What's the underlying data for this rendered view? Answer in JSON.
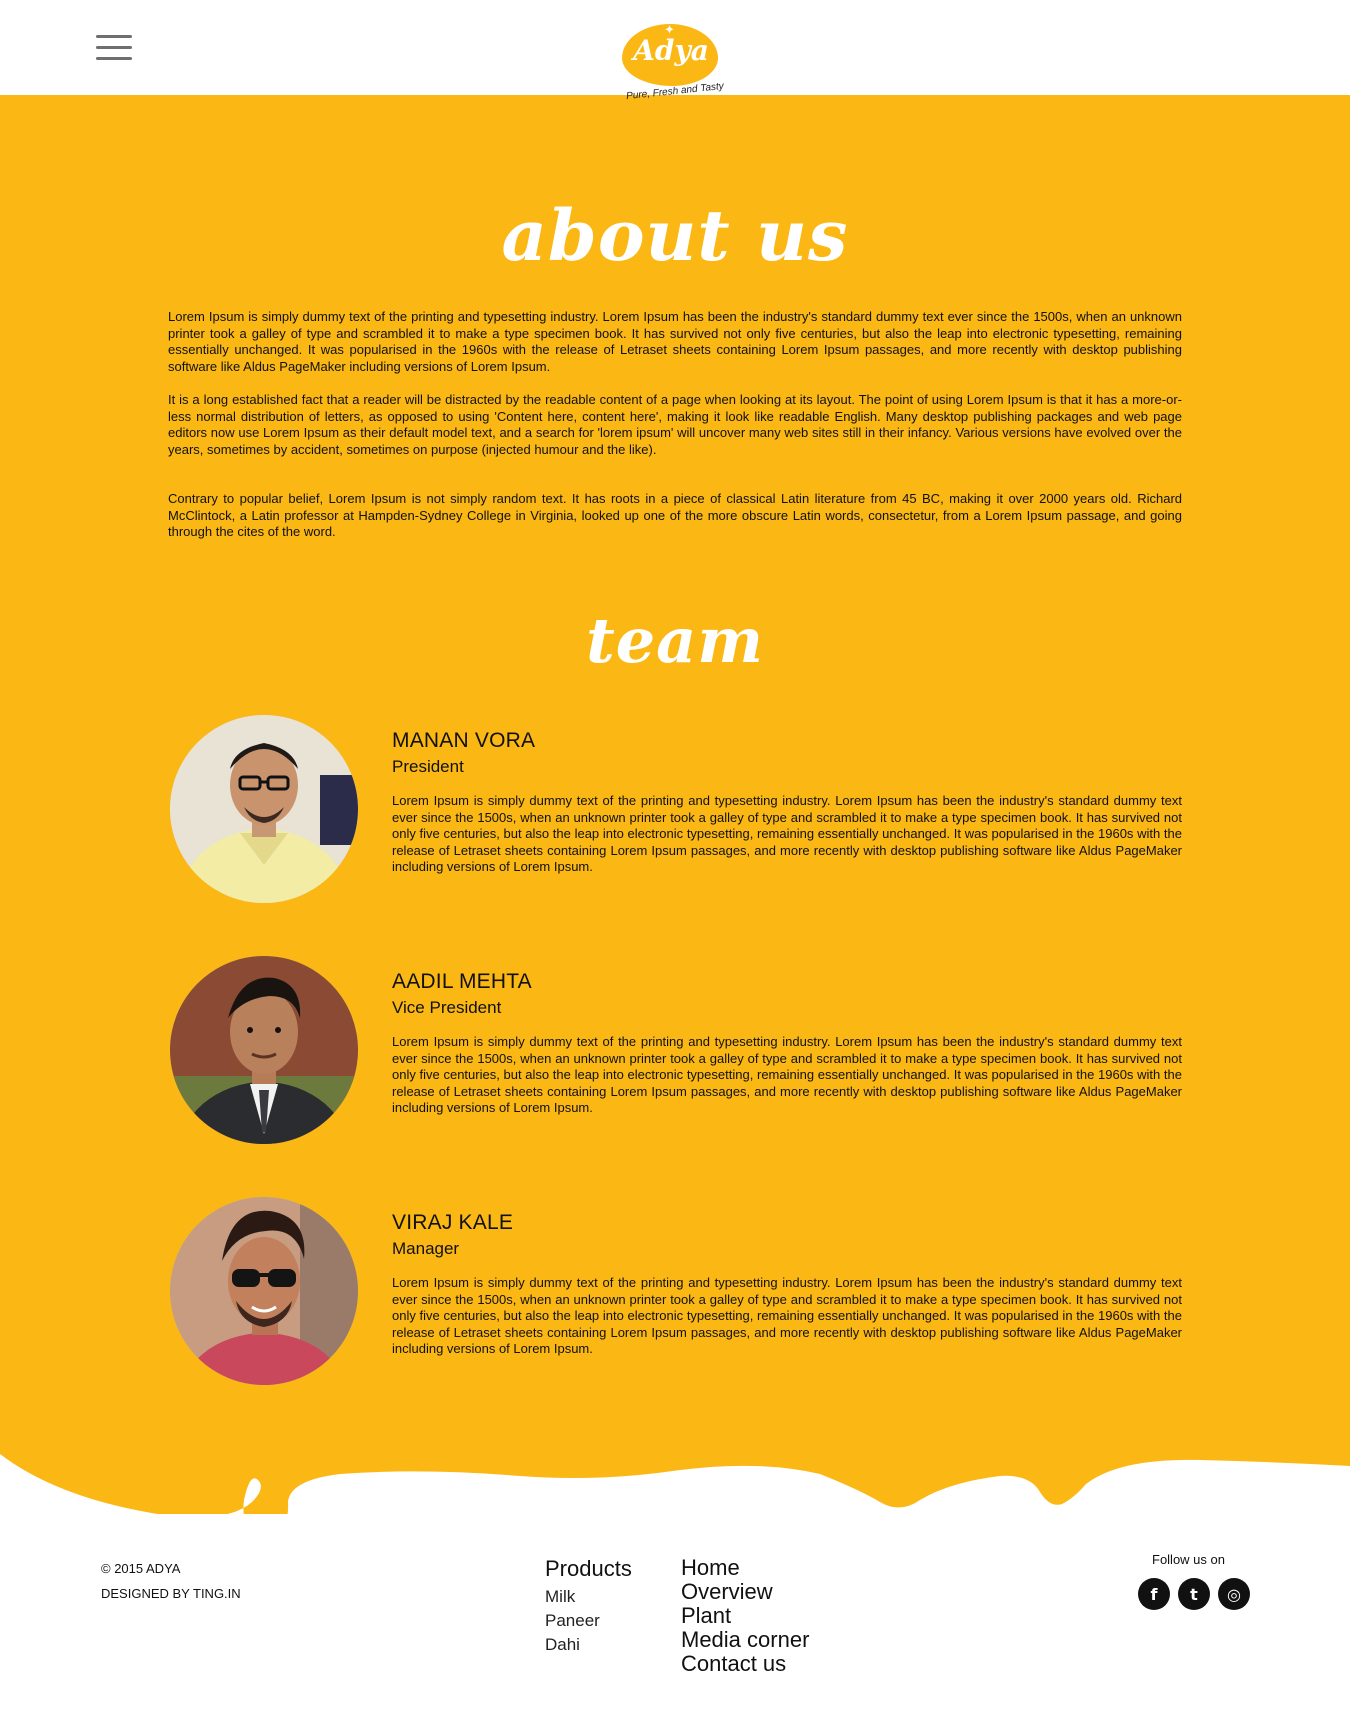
{
  "header": {
    "menu_icon": "hamburger-menu-icon",
    "logo_text": "Adya",
    "logo_tagline": "Pure, Fresh and Tasty"
  },
  "about": {
    "title": "about us",
    "paragraphs": [
      "Lorem Ipsum is simply dummy text of the printing and typesetting industry. Lorem Ipsum has been the industry's standard dummy text ever since the 1500s, when an unknown printer took a galley of type and scrambled it to make a type specimen book. It has survived not only five centuries, but also the leap into electronic typesetting, remaining essentially unchanged. It was popularised in the 1960s with the release of Letraset sheets containing Lorem Ipsum passages, and more recently with desktop publishing software like Aldus PageMaker including versions of Lorem Ipsum.",
      "It is a long established fact that a reader will be distracted by the readable content of a page when looking at its layout. The point of using Lorem Ipsum is that it has a more-or-less normal distribution of letters, as opposed to using 'Content here, content here', making it look like readable English. Many desktop publishing packages and web page editors now use Lorem Ipsum as their default model text, and a search for 'lorem ipsum' will uncover many web sites still in their infancy. Various versions have evolved over the years, sometimes by accident, sometimes on purpose (injected humour and the like).",
      "Contrary to popular belief, Lorem Ipsum is not simply random text. It has roots in a piece of classical Latin literature from 45 BC, making it over 2000 years old. Richard McClintock, a Latin professor at Hampden-Sydney College in Virginia, looked up one of the more obscure Latin words, consectetur, from a Lorem Ipsum passage, and going through the cites of the word."
    ]
  },
  "team": {
    "title": "team",
    "members": [
      {
        "name": "MANAN VORA",
        "role": "President",
        "bio": "Lorem Ipsum is simply dummy text of the printing and typesetting industry. Lorem Ipsum has been the industry's standard dummy text ever since the 1500s, when an unknown printer took a galley of type and scrambled it to make a type specimen book. It has survived not only five centuries, but also the leap into electronic typesetting, remaining essentially unchanged. It was popularised in the 1960s with the release of Letraset sheets containing Lorem Ipsum passages, and more recently with desktop publishing software like Aldus PageMaker including versions of Lorem Ipsum."
      },
      {
        "name": "AADIL MEHTA",
        "role": "Vice President",
        "bio": "Lorem Ipsum is simply dummy text of the printing and typesetting industry. Lorem Ipsum has been the industry's standard dummy text ever since the 1500s, when an unknown printer took a galley of type and scrambled it to make a type specimen book. It has survived not only five centuries, but also the leap into electronic typesetting, remaining essentially unchanged. It was popularised in the 1960s with the release of Letraset sheets containing Lorem Ipsum passages, and more recently with desktop publishing software like Aldus PageMaker including versions of Lorem Ipsum."
      },
      {
        "name": "VIRAJ KALE",
        "role": "Manager",
        "bio": "Lorem Ipsum is simply dummy text of the printing and typesetting industry. Lorem Ipsum has been the industry's standard dummy text ever since the 1500s, when an unknown printer took a galley of type and scrambled it to make a type specimen book. It has survived not only five centuries, but also the leap into electronic typesetting, remaining essentially unchanged. It was popularised in the 1960s with the release of Letraset sheets containing Lorem Ipsum passages, and more recently with desktop publishing software like Aldus PageMaker including versions of Lorem Ipsum."
      }
    ]
  },
  "footer": {
    "copyright": "© 2015 ADYA",
    "designed_by": "DESIGNED BY TING.IN",
    "products": {
      "heading": "Products",
      "items": [
        "Milk",
        "Paneer",
        "Dahi"
      ]
    },
    "nav": [
      "Home",
      "Overview",
      "Plant",
      "Media corner",
      "Contact us"
    ],
    "follow_label": "Follow us on",
    "social": [
      {
        "icon": "facebook-icon",
        "glyph": "f"
      },
      {
        "icon": "twitter-icon",
        "glyph": "t"
      },
      {
        "icon": "instagram-icon",
        "glyph": "◎"
      }
    ]
  },
  "colors": {
    "brand_yellow": "#fbb714",
    "text_dark": "#111111",
    "white": "#ffffff"
  }
}
